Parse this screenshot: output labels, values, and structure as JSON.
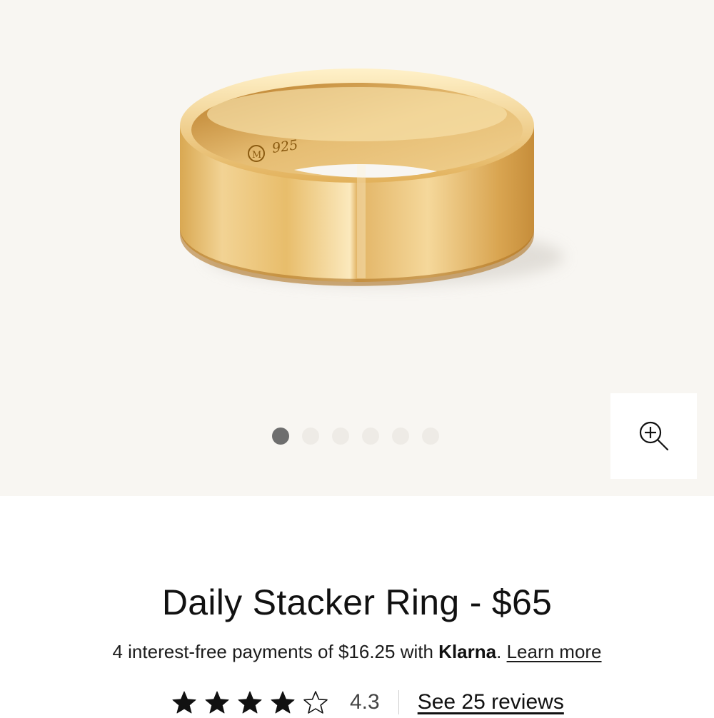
{
  "product": {
    "title": "Daily Stacker Ring - $65",
    "engraving": "925"
  },
  "gallery": {
    "image_count": 6,
    "active_index": 0,
    "zoom_icon": "zoom-in-icon"
  },
  "financing": {
    "text": "4 interest-free payments of $16.25 with ",
    "provider": "Klarna",
    "punctuation": ".",
    "link_label": "Learn more"
  },
  "rating": {
    "value": "4.3",
    "stars_filled": 4,
    "stars_total": 5,
    "reviews_label": "See 25 reviews"
  },
  "colors": {
    "gallery_bg": "#f8f6f2",
    "dot_active": "#6e6e6e",
    "dot_inactive": "#eeebe6"
  }
}
